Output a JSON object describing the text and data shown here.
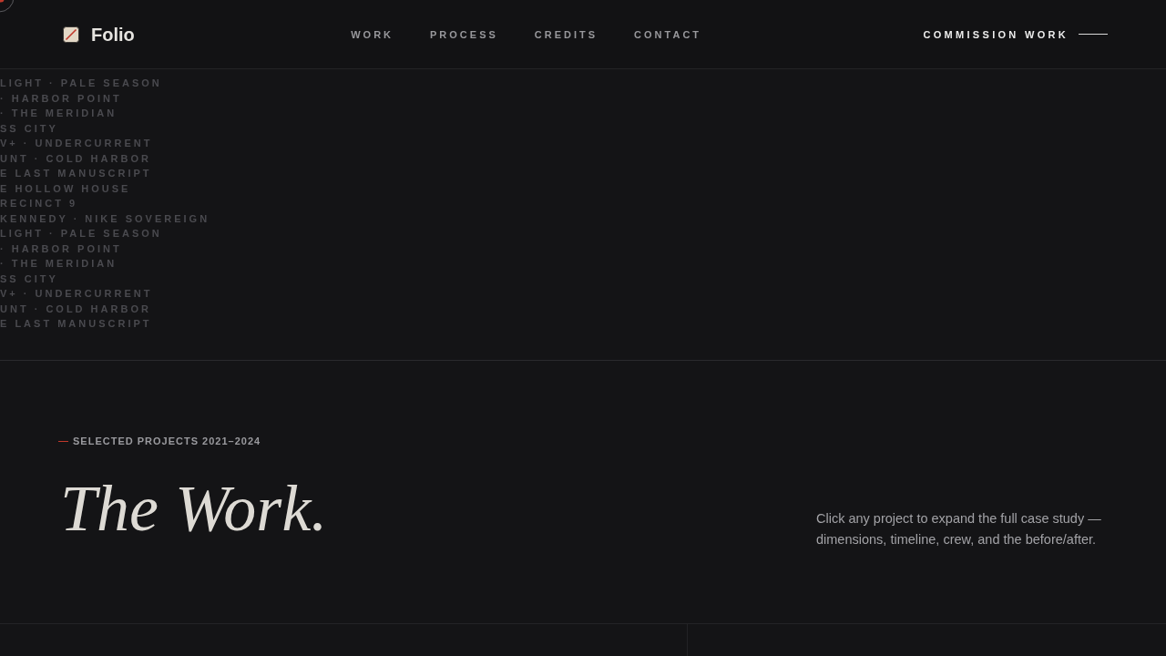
{
  "header": {
    "brand": "Folio",
    "nav": [
      {
        "label": "WORK"
      },
      {
        "label": "PROCESS"
      },
      {
        "label": "CREDITS"
      },
      {
        "label": "CONTACT"
      }
    ],
    "cta": "COMMISSION WORK"
  },
  "ticker": {
    "lines": [
      "LIGHT · PALE SEASON",
      "· HARBOR POINT",
      "· THE MERIDIAN",
      "SS CITY",
      "V+ · UNDERCURRENT",
      "UNT · COLD HARBOR",
      "E LAST MANUSCRIPT",
      "E HOLLOW HOUSE",
      "RECINCT 9",
      "KENNEDY · NIKE SOVEREIGN",
      "LIGHT · PALE SEASON",
      "· HARBOR POINT",
      "· THE MERIDIAN",
      "SS CITY",
      "V+ · UNDERCURRENT",
      "UNT · COLD HARBOR",
      "E LAST MANUSCRIPT"
    ]
  },
  "intro": {
    "eyebrow": "SELECTED PROJECTS 2021–2024",
    "title": "The Work.",
    "description": "Click any project to expand the full case study — dimensions, timeline, crew, and the before/after."
  }
}
